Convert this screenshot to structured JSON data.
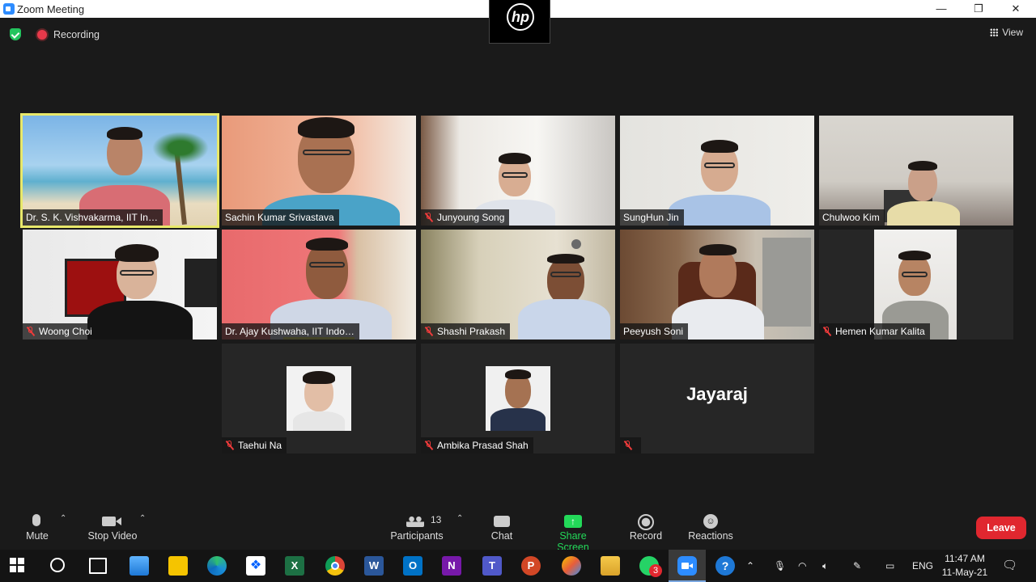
{
  "window": {
    "title": "Zoom Meeting",
    "minimize": "—",
    "restore": "❐",
    "close": "✕"
  },
  "top": {
    "recording_label": "Recording",
    "view_label": "View"
  },
  "participants": [
    {
      "name": "Dr. S. K. Vishvakarma, IIT In…",
      "muted": false,
      "active": true
    },
    {
      "name": "Sachin Kumar Srivastava",
      "muted": false
    },
    {
      "name": "Junyoung Song",
      "muted": true
    },
    {
      "name": "SungHun Jin",
      "muted": false
    },
    {
      "name": "Chulwoo Kim",
      "muted": false
    },
    {
      "name": "Woong Choi",
      "muted": true
    },
    {
      "name": "Dr. Ajay Kushwaha, IIT Indo…",
      "muted": false
    },
    {
      "name": "Shashi Prakash",
      "muted": true
    },
    {
      "name": "Peeyush Soni",
      "muted": false
    },
    {
      "name": "Hemen Kumar Kalita",
      "muted": true
    },
    {
      "name": "Taehui Na",
      "muted": true
    },
    {
      "name": "Ambika Prasad Shah",
      "muted": true
    },
    {
      "name": "Jayaraj",
      "muted": true,
      "display_text": "Jayaraj"
    }
  ],
  "toolbar": {
    "mute": "Mute",
    "stop_video": "Stop Video",
    "participants": "Participants",
    "participants_count": "13",
    "chat": "Chat",
    "share_screen": "Share Screen",
    "record": "Record",
    "reactions": "Reactions",
    "leave": "Leave"
  },
  "taskbar": {
    "language": "ENG",
    "time": "11:47 AM",
    "date": "11-May-21",
    "whatsapp_badge": "3"
  },
  "colors": {
    "active_speaker": "#e8e86a",
    "share_screen": "#23d959",
    "leave": "#e0272f",
    "zoom_blue": "#2d8cff"
  }
}
